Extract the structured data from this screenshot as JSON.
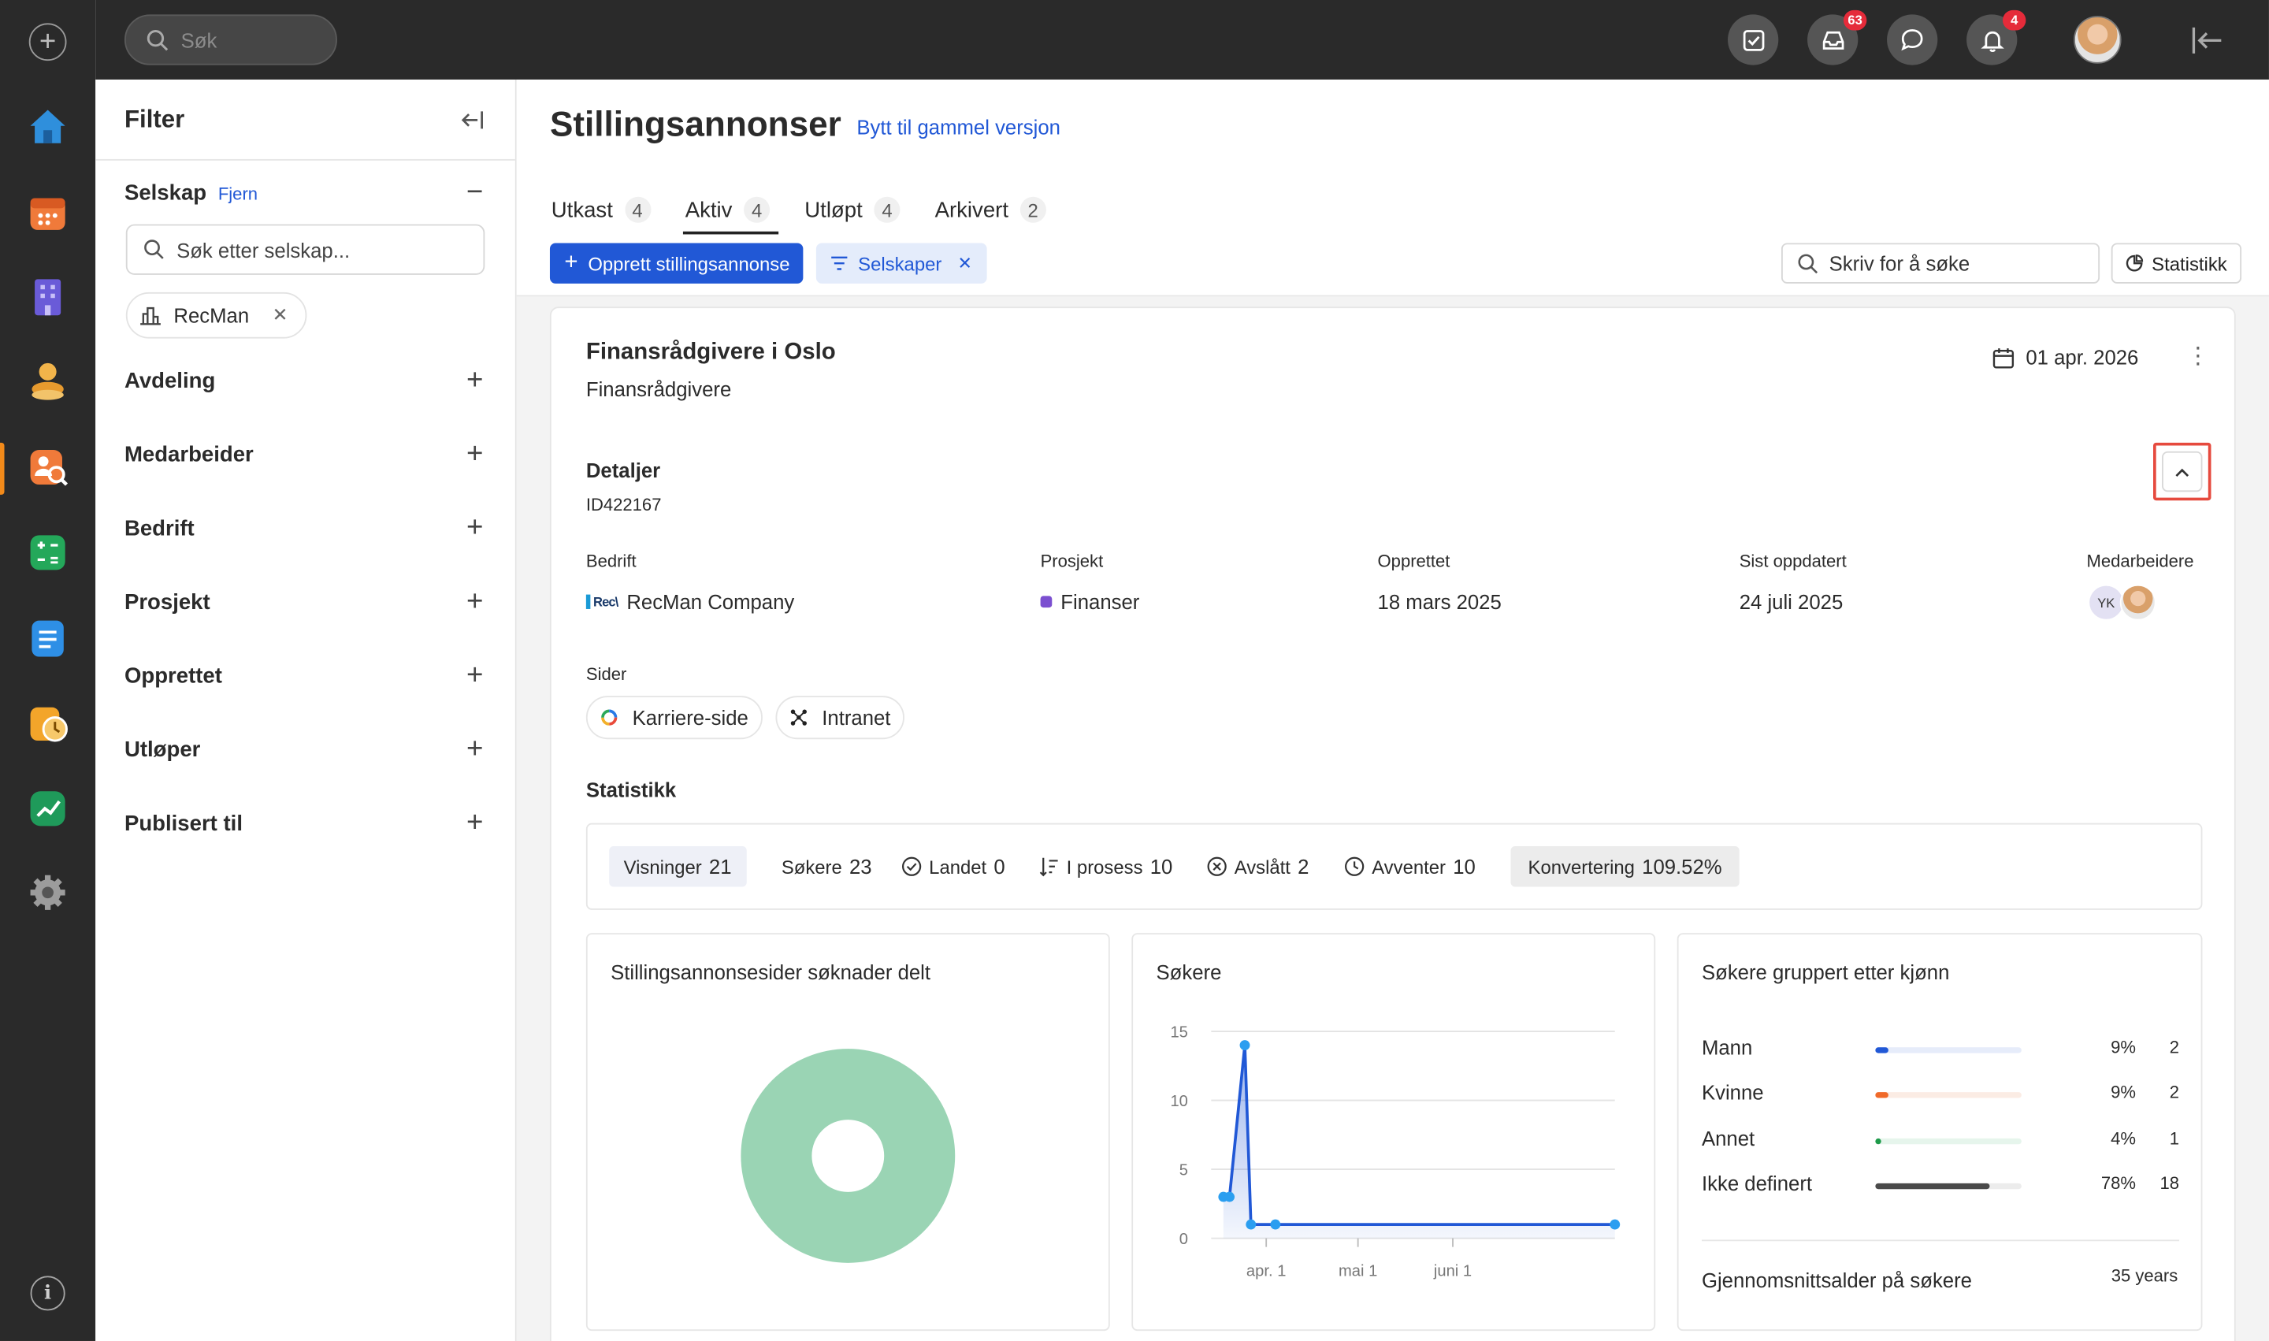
{
  "topbar": {
    "search_placeholder": "Søk",
    "inbox_badge": "63",
    "notif_badge": "4"
  },
  "filter": {
    "title": "Filter",
    "selskap": {
      "label": "Selskap",
      "remove_label": "Fjern",
      "search_placeholder": "Søk etter selskap...",
      "chip": "RecMan"
    },
    "sections": [
      "Avdeling",
      "Medarbeider",
      "Bedrift",
      "Prosjekt",
      "Opprettet",
      "Utløper",
      "Publisert til"
    ]
  },
  "page": {
    "title": "Stillingsannonser",
    "old_version_link": "Bytt til gammel versjon",
    "tabs": [
      {
        "label": "Utkast",
        "count": "4"
      },
      {
        "label": "Aktiv",
        "count": "4"
      },
      {
        "label": "Utløpt",
        "count": "4"
      },
      {
        "label": "Arkivert",
        "count": "2"
      }
    ],
    "create_button": "Opprett stillingsannonse",
    "filter_chip": "Selskaper",
    "search_placeholder": "Skriv for å søke",
    "stats_button": "Statistikk"
  },
  "job": {
    "title": "Finansrådgivere i Oslo",
    "subtitle": "Finansrådgivere",
    "date": "01 apr. 2026",
    "details_label": "Detaljer",
    "id": "ID422167",
    "fields": {
      "bedrift_label": "Bedrift",
      "bedrift_value": "RecMan Company",
      "bedrift_logo_text": "Rec\\",
      "prosjekt_label": "Prosjekt",
      "prosjekt_value": "Finanser",
      "prosjekt_color": "#7b4fd0",
      "opprettet_label": "Opprettet",
      "opprettet_value": "18 mars 2025",
      "oppdatert_label": "Sist oppdatert",
      "oppdatert_value": "24 juli 2025",
      "medarbeidere_label": "Medarbeidere",
      "medarbeider_initials": "YK"
    },
    "sider_label": "Sider",
    "sider": [
      "Karriere-side",
      "Intranet"
    ],
    "statistikk_label": "Statistikk",
    "stats": [
      {
        "label": "Visninger",
        "value": "21"
      },
      {
        "label": "Søkere",
        "value": "23"
      },
      {
        "label": "Landet",
        "value": "0"
      },
      {
        "label": "I prosess",
        "value": "10"
      },
      {
        "label": "Avslått",
        "value": "2"
      },
      {
        "label": "Avventer",
        "value": "10"
      },
      {
        "label": "Konvertering",
        "value": "109.52%"
      }
    ]
  },
  "panels": {
    "donut_title": "Stillingsannonsesider søknader delt",
    "line_title": "Søkere",
    "gender_title": "Søkere gruppert etter kjønn",
    "avg_age_label": "Gjennomsnittsalder på søkere",
    "avg_age_value": "35 years"
  },
  "chart_data": [
    {
      "type": "pie",
      "title": "Stillingsannonsesider søknader delt",
      "slices": [
        {
          "label": "",
          "value": 100,
          "color": "#9ad4b4"
        }
      ]
    },
    {
      "type": "area",
      "title": "Søkere",
      "yticks": [
        0,
        5,
        10,
        15
      ],
      "ylim": [
        0,
        15
      ],
      "xticks": [
        "apr. 1",
        "mai 1",
        "juni 1"
      ],
      "x": [
        "2025-03-18",
        "2025-03-20",
        "2025-03-25",
        "2025-03-27",
        "2025-04-04",
        "2025-07-24"
      ],
      "series": [
        {
          "values": [
            3,
            3,
            14,
            1,
            1,
            1
          ]
        }
      ],
      "color": "#2158d6"
    },
    {
      "type": "bar",
      "title": "Søkere gruppert etter kjønn",
      "categories": [
        "Mann",
        "Kvinne",
        "Annet",
        "Ikke definert"
      ],
      "values": [
        2,
        2,
        1,
        18
      ],
      "percents": [
        "9%",
        "9%",
        "4%",
        "78%"
      ],
      "fractions": [
        0.09,
        0.09,
        0.04,
        0.78
      ],
      "colors": [
        "#2158d6",
        "#f06a2a",
        "#1e9a4a",
        "#4a4a4a"
      ],
      "track_colors": [
        "#e6ecfa",
        "#fbece4",
        "#e6f5ec",
        "#ececec"
      ]
    }
  ]
}
